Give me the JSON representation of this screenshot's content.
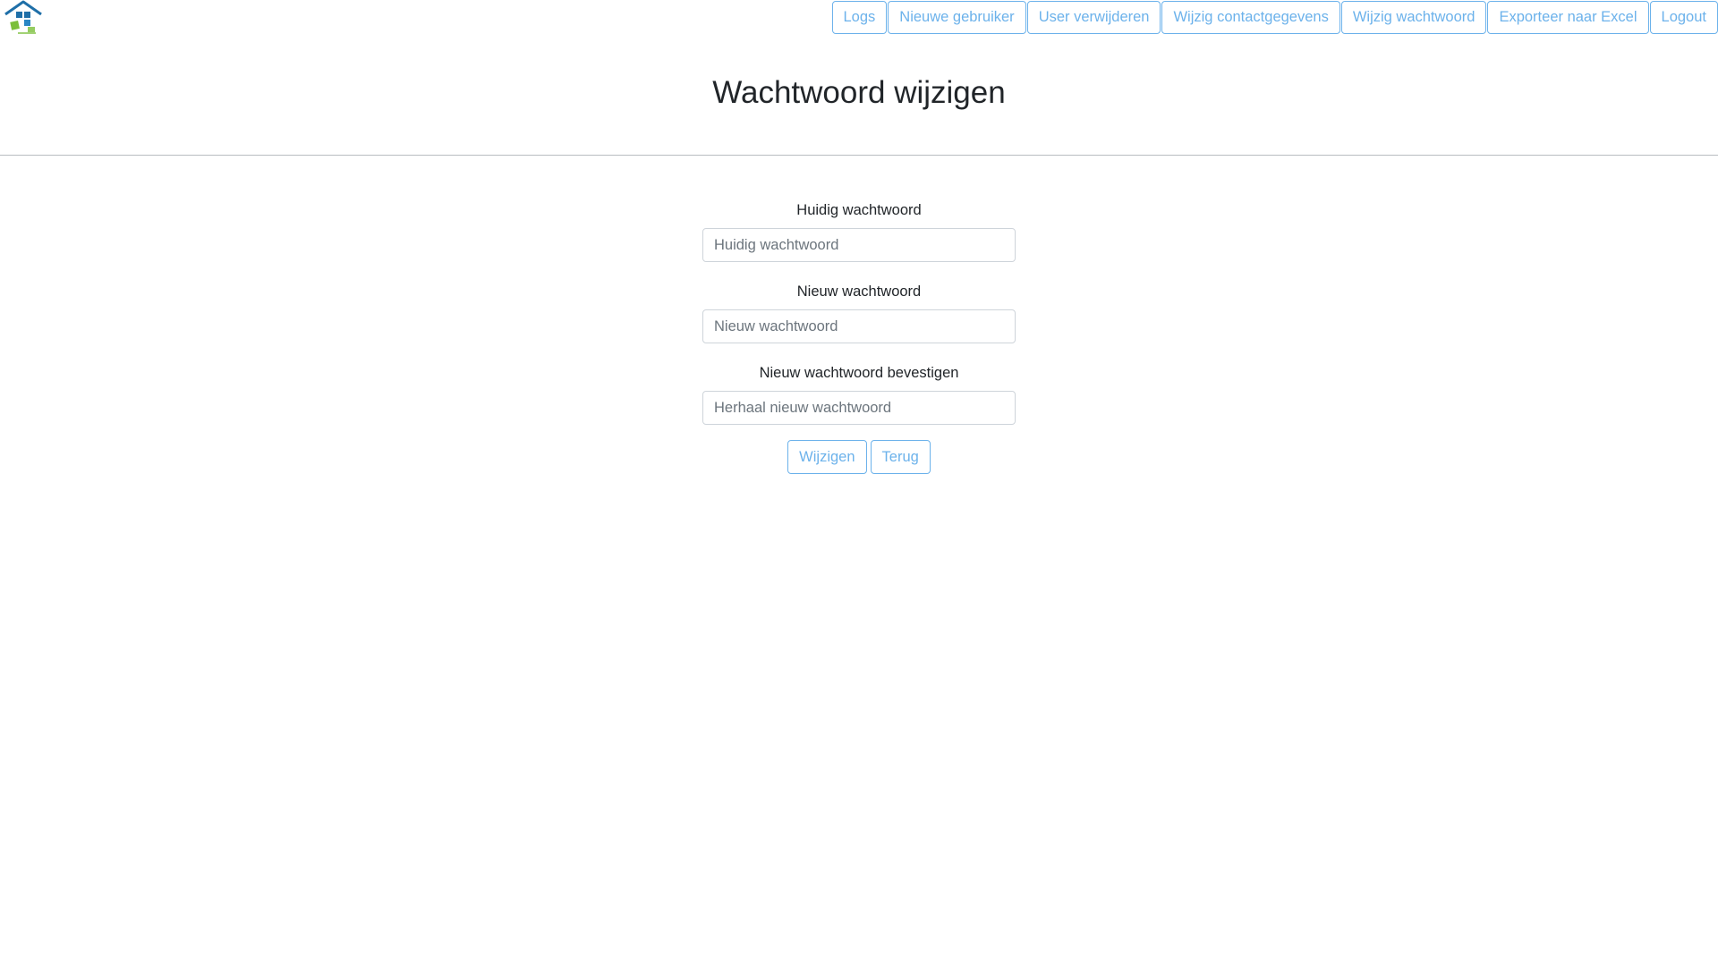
{
  "header": {
    "logo_icon": "house-logo-icon",
    "nav": [
      {
        "label": "Logs"
      },
      {
        "label": "Nieuwe gebruiker"
      },
      {
        "label": "User verwijderen"
      },
      {
        "label": "Wijzig contactgegevens"
      },
      {
        "label": "Wijzig wachtwoord"
      },
      {
        "label": "Exporteer naar Excel"
      },
      {
        "label": "Logout"
      }
    ]
  },
  "page": {
    "title": "Wachtwoord wijzigen"
  },
  "form": {
    "current": {
      "label": "Huidig wachtwoord",
      "placeholder": "Huidig wachtwoord",
      "value": ""
    },
    "new": {
      "label": "Nieuw wachtwoord",
      "placeholder": "Nieuw wachtwoord",
      "value": ""
    },
    "confirm": {
      "label": "Nieuw wachtwoord bevestigen",
      "placeholder": "Herhaal nieuw wachtwoord",
      "value": ""
    },
    "submit_label": "Wijzigen",
    "back_label": "Terug"
  },
  "colors": {
    "accent": "#6cb2eb",
    "logo_blue": "#1f6fa8",
    "logo_green": "#7bbf3a"
  }
}
